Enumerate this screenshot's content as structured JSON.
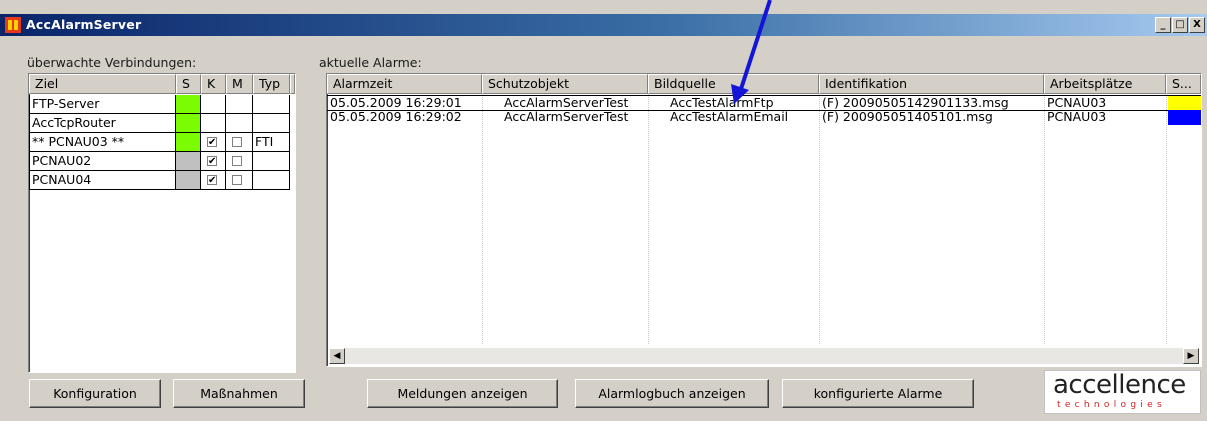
{
  "window": {
    "title": "AccAlarmServer",
    "controls": [
      "_",
      "□",
      "X"
    ]
  },
  "connections": {
    "label": "überwachte Verbindungen:",
    "columns": [
      "Ziel",
      "S",
      "K",
      "M",
      "Typ"
    ],
    "rows": [
      {
        "ziel": "FTP-Server",
        "status_color": "#7cfc00",
        "k": null,
        "m": null,
        "typ": ""
      },
      {
        "ziel": "AccTcpRouter",
        "status_color": "#7cfc00",
        "k": null,
        "m": null,
        "typ": ""
      },
      {
        "ziel": "** PCNAU03 **",
        "status_color": "#7cfc00",
        "k": true,
        "m": false,
        "typ": "FTI"
      },
      {
        "ziel": "PCNAU02",
        "status_color": "#c0c0c0",
        "k": true,
        "m": false,
        "typ": ""
      },
      {
        "ziel": "PCNAU04",
        "status_color": "#c0c0c0",
        "k": true,
        "m": false,
        "typ": ""
      }
    ]
  },
  "alarms": {
    "label": "aktuelle Alarme:",
    "columns": [
      "Alarmzeit",
      "Schutzobjekt",
      "Bildquelle",
      "Identifikation",
      "Arbeitsplätze",
      "S..."
    ],
    "rows": [
      {
        "zeit": "05.05.2009 16:29:01",
        "schutzobjekt": "AccAlarmServerTest",
        "bildquelle": "AccTestAlarmFtp",
        "ident": "(F) 20090505142901133.msg",
        "arbeitsplatz": "PCNAU03",
        "status_color": "#ffff00"
      },
      {
        "zeit": "05.05.2009 16:29:02",
        "schutzobjekt": "AccAlarmServerTest",
        "bildquelle": "AccTestAlarmEmail",
        "ident": "(F) 200905051405101.msg",
        "arbeitsplatz": "PCNAU03",
        "status_color": "#0000ff"
      }
    ]
  },
  "buttons": {
    "konfiguration": "Konfiguration",
    "massnahmen": "Maßnahmen",
    "meldungen": "Meldungen anzeigen",
    "alarmlogbuch": "Alarmlogbuch anzeigen",
    "konfigurierte": "konfigurierte Alarme"
  },
  "logo": {
    "main": "accellence",
    "sub": "technologies"
  },
  "icons": {
    "app": "alarm-app-icon",
    "scroll_left": "scroll-left-arrow-icon",
    "scroll_right": "scroll-right-arrow-icon",
    "pointer": "pointer-arrow-annotation-icon"
  },
  "colors": {
    "title_bar_start": "#0a246a",
    "window_bg": "#d4d0c8",
    "annotation_arrow": "#1515d8",
    "logo_accent": "#d42020"
  }
}
